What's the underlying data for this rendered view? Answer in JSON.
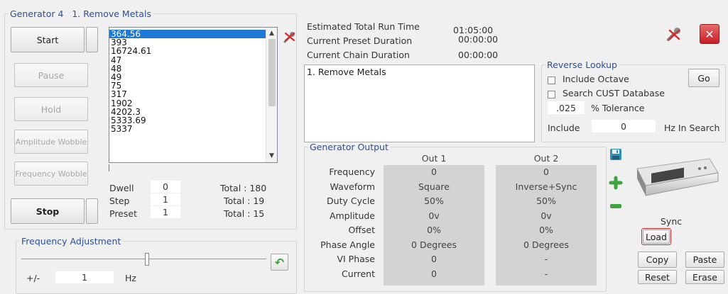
{
  "generator": {
    "name": "Generator 4",
    "program": "1. Remove Metals"
  },
  "controls": {
    "start": "Start",
    "pause": "Pause",
    "hold": "Hold",
    "amplitude_wobble": "Amplitude Wobble",
    "frequency_wobble": "Frequency Wobble",
    "stop": "Stop"
  },
  "frequency_list": [
    "364.56",
    "393",
    "16724.61",
    "47",
    "48",
    "49",
    "75",
    "317",
    "1902",
    "4202.3",
    "5333.69",
    "5337"
  ],
  "selected_index": 0,
  "stats": {
    "dwell_label": "Dwell",
    "dwell_value": "0",
    "dwell_total": "Total : 180",
    "step_label": "Step",
    "step_value": "1",
    "step_total": "Total : 19",
    "preset_label": "Preset",
    "preset_value": "1",
    "preset_total": "Total : 15"
  },
  "freq_adjust": {
    "title": "Frequency Adjustment",
    "pm_label": "+/-",
    "value": "1",
    "unit": "Hz"
  },
  "run_time": {
    "est_label": "Estimated Total Run Time",
    "est_value": "01:05:00",
    "preset_label": "Current Preset Duration",
    "preset_value": "00:00:00",
    "chain_label": "Current Chain Duration",
    "chain_value": "00:00:00"
  },
  "program_list": [
    "1. Remove Metals"
  ],
  "reverse_lookup": {
    "title": "Reverse Lookup",
    "include_octave": "Include Octave",
    "go": "Go",
    "search_cust": "Search CUST Database",
    "tolerance_value": ".025",
    "tolerance_label": "% Tolerance",
    "include_label": "Include",
    "include_value": "0",
    "hz_label": "Hz In Search"
  },
  "output": {
    "title": "Generator Output",
    "col1": "Out 1",
    "col2": "Out 2",
    "rows": [
      {
        "label": "Frequency",
        "v1": "0",
        "v2": "0"
      },
      {
        "label": "Waveform",
        "v1": "Square",
        "v2": "Inverse+Sync"
      },
      {
        "label": "Duty Cycle",
        "v1": "50%",
        "v2": "50%"
      },
      {
        "label": "Amplitude",
        "v1": "0v",
        "v2": "0v"
      },
      {
        "label": "Offset",
        "v1": "0%",
        "v2": "0%"
      },
      {
        "label": "Phase Angle",
        "v1": "0 Degrees",
        "v2": "0 Degrees"
      },
      {
        "label": "VI Phase",
        "v1": "0",
        "v2": "-"
      },
      {
        "label": "Current",
        "v1": "0",
        "v2": "-"
      }
    ]
  },
  "sync_panel": {
    "sync": "Sync",
    "load": "Load",
    "copy": "Copy",
    "paste": "Paste",
    "reset": "Reset",
    "erase": "Erase"
  },
  "icons": {
    "save": "save-icon",
    "add": "plus-icon",
    "remove": "minus-icon",
    "undo": "undo-icon",
    "wrench": "wrench-icon",
    "close": "close-icon"
  },
  "colors": {
    "selection": "#1e79d6",
    "output_bg": "#d3d3d3",
    "legend_blue": "#2a4f9a",
    "close_red": "#d9272e"
  }
}
